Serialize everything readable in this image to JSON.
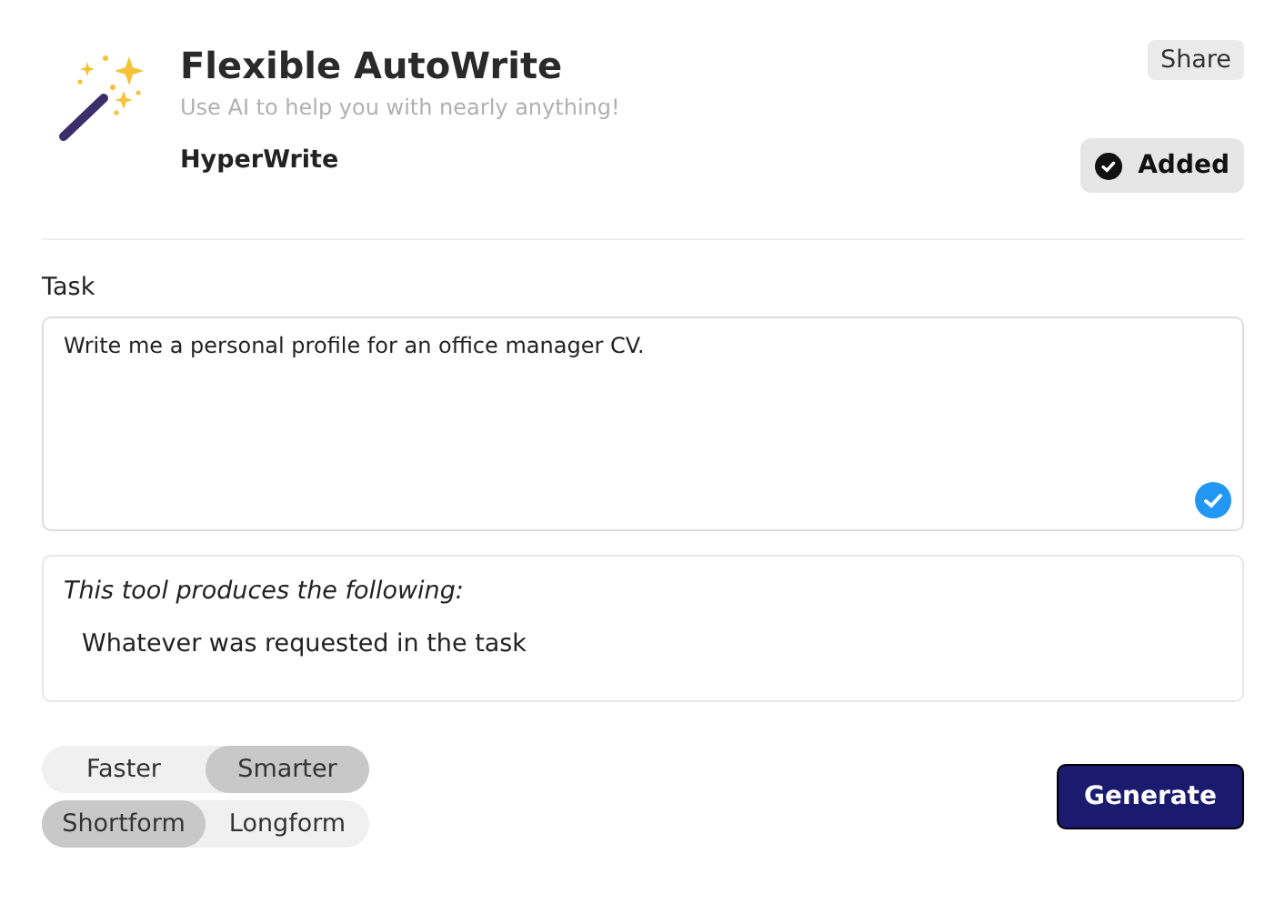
{
  "tool": {
    "title": "Flexible AutoWrite",
    "subtitle": "Use AI to help you with nearly anything!",
    "author": "HyperWrite"
  },
  "share_button": "Share",
  "added_button": {
    "label": "Added",
    "added": true
  },
  "task": {
    "label": "Task",
    "value": "Write me a personal profile for an office manager CV.",
    "verified": true
  },
  "output_info": {
    "heading": "This tool produces the following:",
    "text": "Whatever was requested in the task"
  },
  "toggle_groups": [
    [
      {
        "label": "Faster",
        "selected": false
      },
      {
        "label": "Smarter",
        "selected": true
      }
    ],
    [
      {
        "label": "Shortform",
        "selected": true
      },
      {
        "label": "Longform",
        "selected": false
      }
    ]
  ],
  "generate_button": "Generate"
}
